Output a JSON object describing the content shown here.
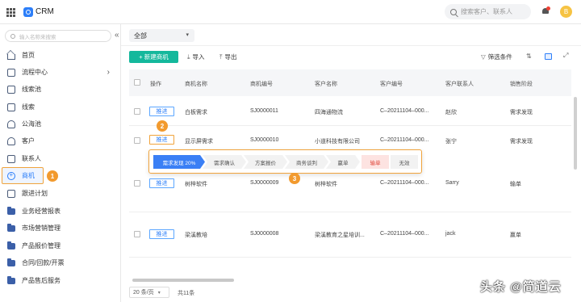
{
  "app": {
    "title": "CRM",
    "avatar_initial": "B"
  },
  "header": {
    "search_placeholder": "搜索客户、联系人"
  },
  "sidebar": {
    "search_placeholder": "输入名称来搜索",
    "collapse_glyph": "«",
    "items": [
      {
        "label": "首页",
        "icon": "home-icon"
      },
      {
        "label": "流程中心",
        "icon": "flow-icon",
        "has_chevron": true
      },
      {
        "label": "线索池",
        "icon": "pool-icon"
      },
      {
        "label": "线索",
        "icon": "lead-icon"
      },
      {
        "label": "公海池",
        "icon": "public-pool-icon"
      },
      {
        "label": "客户",
        "icon": "customer-icon"
      },
      {
        "label": "联系人",
        "icon": "contact-icon"
      },
      {
        "label": "商机",
        "icon": "opportunity-icon",
        "active": true
      },
      {
        "label": "跟进计划",
        "icon": "plan-icon"
      },
      {
        "label": "业务经营报表",
        "icon": "folder-icon"
      },
      {
        "label": "市场营销管理",
        "icon": "folder-icon"
      },
      {
        "label": "产品报价管理",
        "icon": "folder-icon"
      },
      {
        "label": "合同/回款/开票",
        "icon": "folder-icon"
      },
      {
        "label": "产品售后服务",
        "icon": "folder-icon"
      }
    ]
  },
  "filter": {
    "selected": "全部"
  },
  "toolbar": {
    "new_label": "+ 新建商机",
    "import_label": "导入",
    "export_label": "导出",
    "filter_label": "筛选条件"
  },
  "table": {
    "headers": [
      "操作",
      "商机名称",
      "商机编号",
      "客户名称",
      "客户编号",
      "客户联系人",
      "销售阶段"
    ],
    "rows": [
      {
        "action": "推进",
        "name": "白板需求",
        "code": "SJ0000011",
        "customer": "四海通物流",
        "customer_code": "C–20211104–000...",
        "contact": "赵欣",
        "stage": "需求发现"
      },
      {
        "action": "推进",
        "name": "显示屏需求",
        "code": "SJ0000010",
        "customer": "小道科技有限公司",
        "customer_code": "C–20211104–000...",
        "contact": "张宁",
        "stage": "需求发现"
      },
      {
        "action": "推进",
        "name": "树梓软件",
        "code": "SJ0000009",
        "customer": "树梓软件",
        "customer_code": "C–20211104–000...",
        "contact": "Sarry",
        "stage": "输单"
      },
      {
        "action": "推进",
        "name": "梁溪教培",
        "code": "SJ0000008",
        "customer": "梁溪教育之星培训...",
        "customer_code": "C–20211104–000...",
        "contact": "jack",
        "stage": "赢单"
      }
    ]
  },
  "stage_popup": {
    "stages": [
      "需求发现 20%",
      "需求确认",
      "方案报价",
      "商务谈判",
      "赢单",
      "输单",
      "无效"
    ]
  },
  "annotations": [
    "1",
    "2",
    "3"
  ],
  "footer": {
    "page_size": "20 条/页",
    "total": "共11条"
  },
  "watermark": "头条 @简道云"
}
